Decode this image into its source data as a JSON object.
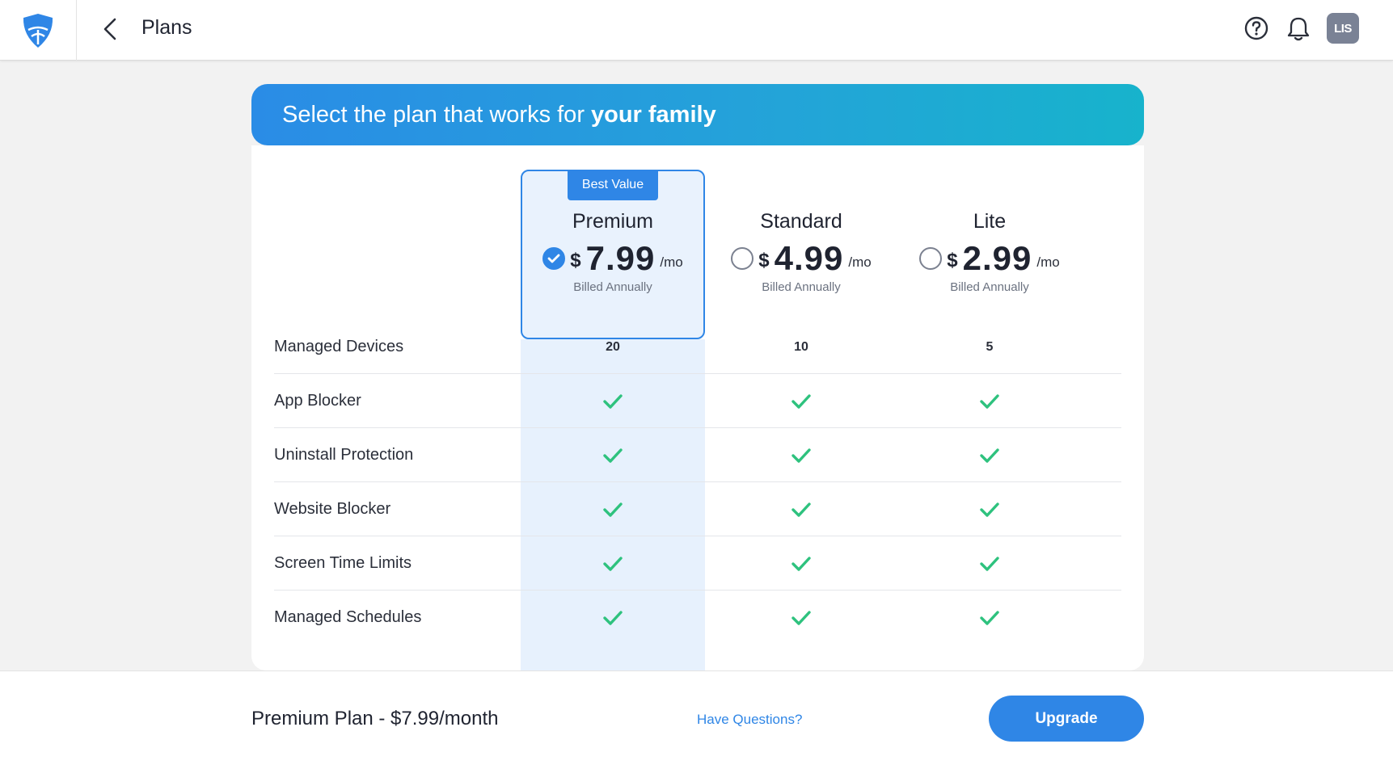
{
  "header": {
    "title": "Plans",
    "avatar_initials": "LIS"
  },
  "hero": {
    "text_regular": "Select the plan that works for",
    "text_bold": "your family"
  },
  "plans": [
    {
      "name": "Premium",
      "currency": "$",
      "amount": "7.99",
      "per": "/mo",
      "billing": "Billed Annually",
      "selected": true,
      "badge": "Best Value"
    },
    {
      "name": "Standard",
      "currency": "$",
      "amount": "4.99",
      "per": "/mo",
      "billing": "Billed Annually",
      "selected": false
    },
    {
      "name": "Lite",
      "currency": "$",
      "amount": "2.99",
      "per": "/mo",
      "billing": "Billed Annually",
      "selected": false
    }
  ],
  "features": [
    {
      "label": "Managed Devices",
      "values": [
        "20",
        "10",
        "5"
      ]
    },
    {
      "label": "App Blocker",
      "values": [
        "check",
        "check",
        "check"
      ]
    },
    {
      "label": "Uninstall Protection",
      "values": [
        "check",
        "check",
        "check"
      ]
    },
    {
      "label": "Website Blocker",
      "values": [
        "check",
        "check",
        "check"
      ]
    },
    {
      "label": "Screen Time Limits",
      "values": [
        "check",
        "check",
        "check"
      ]
    },
    {
      "label": "Managed Schedules",
      "values": [
        "check",
        "check",
        "check"
      ]
    }
  ],
  "footer": {
    "selected_plan": "Premium Plan - $7.99/month",
    "help_link": "Have Questions?",
    "upgrade_label": "Upgrade"
  },
  "colors": {
    "accent": "#2f86e6",
    "check": "#2ec27e",
    "hero_start": "#2a8ce6",
    "hero_end": "#17b3cc"
  }
}
